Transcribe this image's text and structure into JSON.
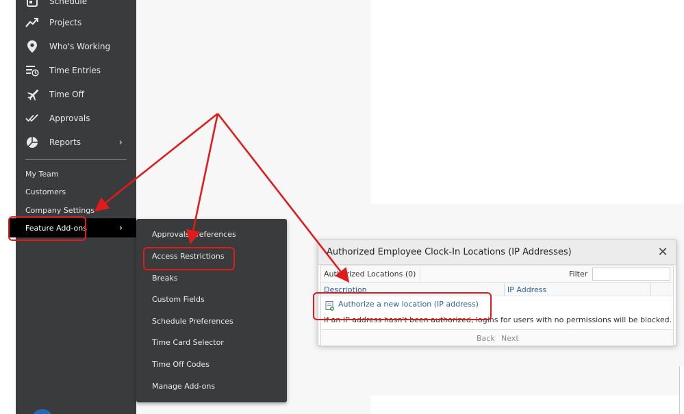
{
  "sidebar": {
    "top_items": [
      {
        "label": "Schedule",
        "icon": "calendar-icon"
      },
      {
        "label": "Projects",
        "icon": "trend-chart-icon"
      },
      {
        "label": "Who's Working",
        "icon": "location-pin-icon"
      },
      {
        "label": "Time Entries",
        "icon": "list-clock-icon"
      },
      {
        "label": "Time Off",
        "icon": "airplane-icon"
      },
      {
        "label": "Approvals",
        "icon": "double-check-icon"
      },
      {
        "label": "Reports",
        "icon": "pie-chart-icon",
        "chevron": "›"
      }
    ],
    "settings_items": [
      {
        "label": "My Team"
      },
      {
        "label": "Customers"
      },
      {
        "label": "Company Settings"
      },
      {
        "label": "Feature Add-ons",
        "chevron": "›"
      }
    ]
  },
  "flyout": {
    "items": [
      "Approvals Preferences",
      "Access Restrictions",
      "Breaks",
      "Custom Fields",
      "Schedule Preferences",
      "Time Card Selector",
      "Time Off Codes",
      "Manage Add-ons"
    ]
  },
  "dialog": {
    "title": "Authorized Employee Clock-In Locations (IP Addresses)",
    "close": "✕",
    "count_label": "Authorized Locations (0)",
    "filter_label": "Filter",
    "filter_value": "",
    "columns": {
      "description": "Description",
      "ip": "IP Address"
    },
    "authorize_link": "Authorize a new location (IP address)",
    "notice": "If an IP address hasn't been authorized, logins for users with no permissions will be blocked.",
    "pager": {
      "back": "Back",
      "next": "Next"
    }
  },
  "annotation": {
    "color": "#e01b1b"
  }
}
